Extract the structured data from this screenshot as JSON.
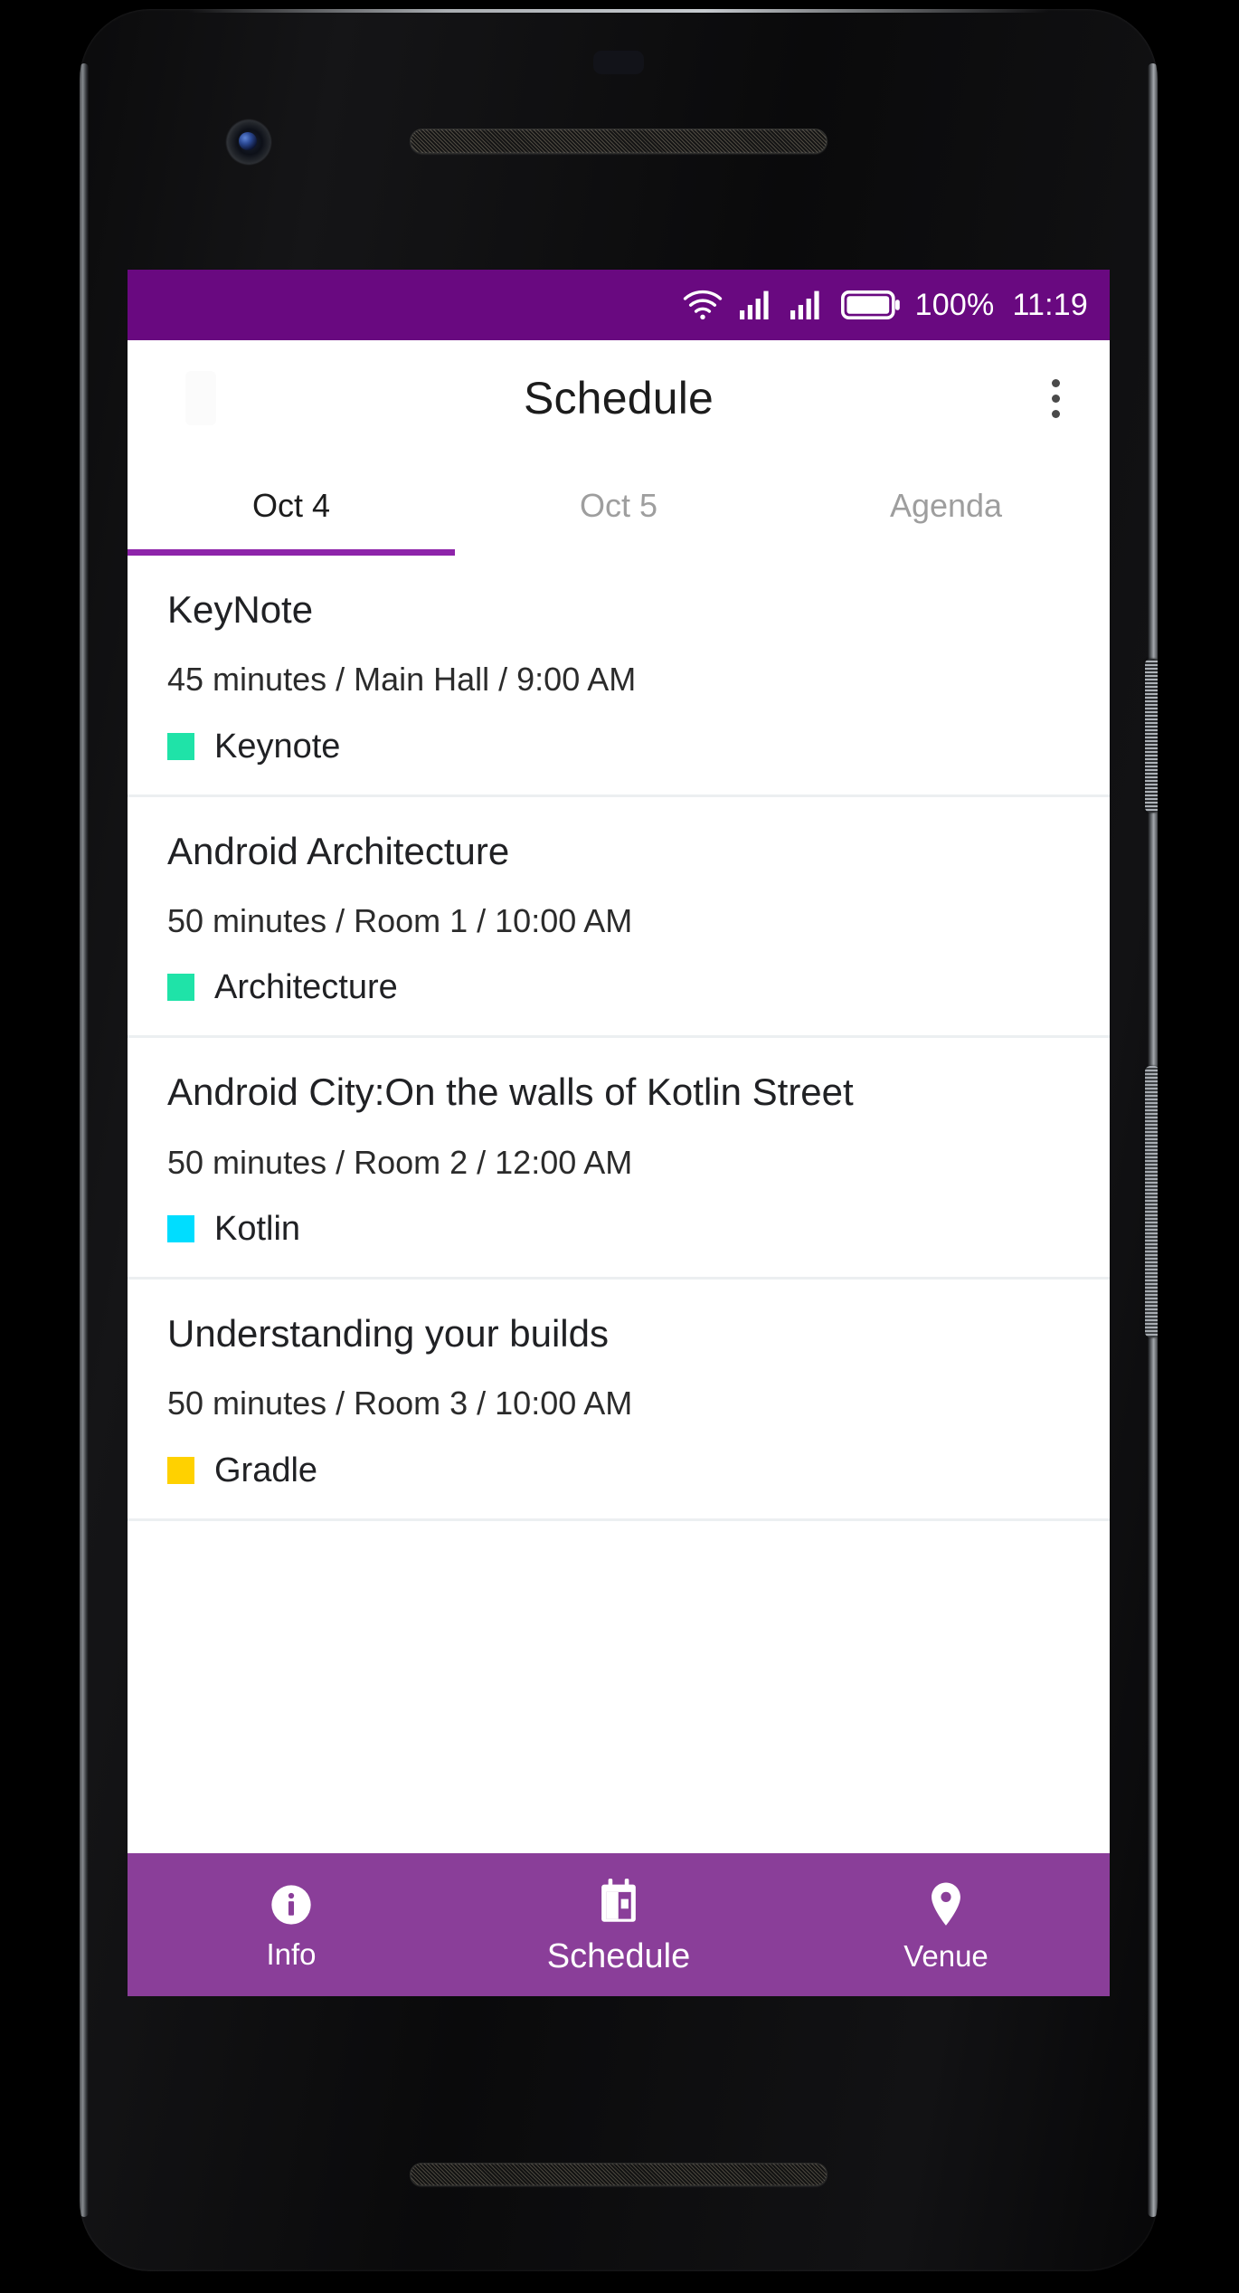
{
  "device": {
    "frame_name": "android-phone-frame"
  },
  "status_bar": {
    "battery_percent": "100%",
    "time": "11:19",
    "icons": [
      "wifi-icon",
      "signal-icon",
      "signal-icon",
      "battery-icon"
    ],
    "background_color": "#690980",
    "text_color": "#ffffff"
  },
  "app_bar": {
    "title": "Schedule",
    "overflow_menu_name": "overflow-menu-icon"
  },
  "tabs": {
    "active_index": 0,
    "indicator_color": "#8e24aa",
    "items": [
      {
        "label": "Oct 4"
      },
      {
        "label": "Oct 5"
      },
      {
        "label": "Agenda"
      }
    ]
  },
  "sessions": [
    {
      "title": "KeyNote",
      "meta": "45 minutes / Main Hall / 9:00 AM",
      "tag_label": "Keynote",
      "tag_color": "#1FE3A8"
    },
    {
      "title": "Android Architecture",
      "meta": "50 minutes / Room 1 / 10:00 AM",
      "tag_label": "Architecture",
      "tag_color": "#1FE3A8"
    },
    {
      "title": "Android City:On the walls of Kotlin Street",
      "meta": "50 minutes / Room 2 / 12:00 AM",
      "tag_label": "Kotlin",
      "tag_color": "#00DDFF"
    },
    {
      "title": "Understanding your builds",
      "meta": "50 minutes / Room 3 / 10:00 AM",
      "tag_label": "Gradle",
      "tag_color": "#FFD100"
    }
  ],
  "bottom_nav": {
    "background_color": "#8a3e99",
    "active_index": 1,
    "items": [
      {
        "label": "Info",
        "icon": "info-circle-icon"
      },
      {
        "label": "Schedule",
        "icon": "calendar-icon"
      },
      {
        "label": "Venue",
        "icon": "location-pin-icon"
      }
    ]
  }
}
